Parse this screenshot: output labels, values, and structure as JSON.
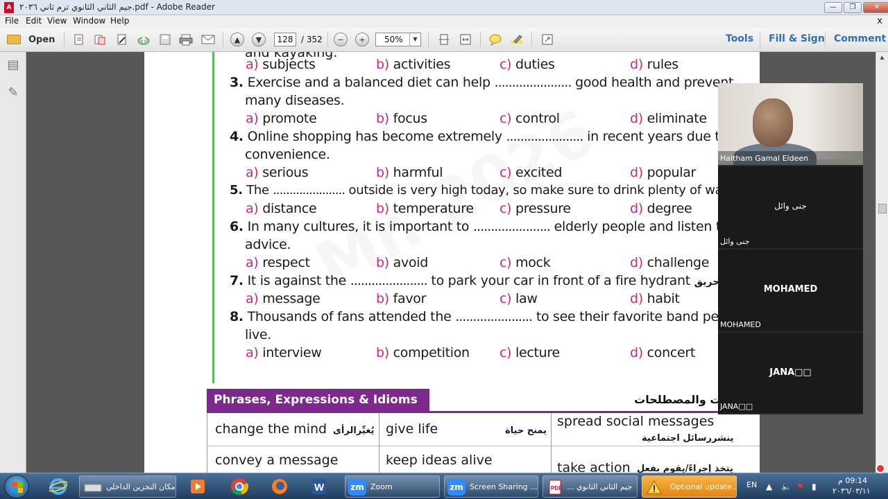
{
  "window": {
    "title": "جيم الثاني الثانوي ترم ثاني ٢٠٣٦.pdf - Adobe Reader",
    "min": "—",
    "max": "❐",
    "close": "✕"
  },
  "menu": {
    "items": [
      "File",
      "Edit",
      "View",
      "Window",
      "Help"
    ],
    "close": "x"
  },
  "toolbar": {
    "open_label": "Open",
    "page_current": "128",
    "page_total": "/ 352",
    "zoom_value": "50%",
    "links": [
      "Tools",
      "Fill & Sign",
      "Comment"
    ]
  },
  "document": {
    "cutoff_line": "and kayaking.",
    "questions": [
      {
        "num": "",
        "text": "",
        "options": [
          [
            "a)",
            "subjects"
          ],
          [
            "b)",
            "activities"
          ],
          [
            "c)",
            "duties"
          ],
          [
            "d)",
            "rules"
          ]
        ]
      },
      {
        "num": "3.",
        "line1_a": "Exercise and a balanced diet can help",
        "dots": "......................",
        "line1_b": "good health and prevent",
        "line2": "many diseases.",
        "options": [
          [
            "a)",
            "promote"
          ],
          [
            "b)",
            "focus"
          ],
          [
            "c)",
            "control"
          ],
          [
            "d)",
            "eliminate"
          ]
        ]
      },
      {
        "num": "4.",
        "line1_a": "Online shopping has become extremely",
        "dots": "......................",
        "line1_b": "in recent years due to its",
        "line2": "convenience.",
        "options": [
          [
            "a)",
            "serious"
          ],
          [
            "b)",
            "harmful"
          ],
          [
            "c)",
            "excited"
          ],
          [
            "d)",
            "popular"
          ]
        ]
      },
      {
        "num": "5.",
        "line1_a": "The",
        "dots": "......................",
        "line1_b": "outside is very high today, so make sure to drink plenty of water.",
        "line2": "",
        "options": [
          [
            "a)",
            "distance"
          ],
          [
            "b)",
            "temperature"
          ],
          [
            "c)",
            "pressure"
          ],
          [
            "d)",
            "degree"
          ]
        ]
      },
      {
        "num": "6.",
        "line1_a": "In many cultures, it is important to",
        "dots": "......................",
        "line1_b": "elderly people and listen to their",
        "line2": "advice.",
        "options": [
          [
            "a)",
            "respect"
          ],
          [
            "b)",
            "avoid"
          ],
          [
            "c)",
            "mock"
          ],
          [
            "d)",
            "challenge"
          ]
        ]
      },
      {
        "num": "7.",
        "line1_a": "It is against the",
        "dots": "......................",
        "line1_b": "to park your car in front of a fire hydrant",
        "ar_note": "صنبورحريق.",
        "line2": "",
        "options": [
          [
            "a)",
            "message"
          ],
          [
            "b)",
            "favor"
          ],
          [
            "c)",
            "law"
          ],
          [
            "d)",
            "habit"
          ]
        ]
      },
      {
        "num": "8.",
        "line1_a": "Thousands of fans attended the",
        "dots": "......................",
        "line1_b": "to see their favorite band perform",
        "line2": "live.",
        "options": [
          [
            "a)",
            "interview"
          ],
          [
            "b)",
            "competition"
          ],
          [
            "c)",
            "lecture"
          ],
          [
            "d)",
            "concert"
          ]
        ]
      }
    ],
    "section": {
      "title": "Phrases, Expressions & Idioms",
      "title_ar": "التعبيرات والمصطلحات"
    },
    "idioms": [
      {
        "en": "change the mind",
        "ar": "يُغيِّرالرأى"
      },
      {
        "en": "give life",
        "ar": "يمنح حياة"
      },
      {
        "en": "spread social messages",
        "ar": "ينشررسائل اجتماعية"
      },
      {
        "en": "convey a message",
        "ar": ""
      },
      {
        "en": "keep ideas alive",
        "ar": ""
      },
      {
        "en": "take action",
        "ar": "يتخذ إجراءً/يقوم بفعل"
      }
    ]
  },
  "zoom": {
    "participants": [
      {
        "name": "Haitham Gamal Eldeen",
        "center": ""
      },
      {
        "name": "جنى وائل",
        "center": "جنى وائل"
      },
      {
        "name": "MOHAMED",
        "center": "MOHAMED"
      },
      {
        "name": "JANA□□",
        "center": "JANA□□"
      }
    ]
  },
  "taskbar": {
    "explorer_label": "مكان التخزين الداخلي",
    "zoom_label": "Zoom",
    "screen_share_label": "Screen Sharing ...",
    "pdf_label": "جيم الثاني الثانوي ...",
    "update_label": "Optional update...",
    "lang": "EN",
    "time": "09:14 م",
    "date": "٢٠٣٦/٠٣/١١"
  }
}
